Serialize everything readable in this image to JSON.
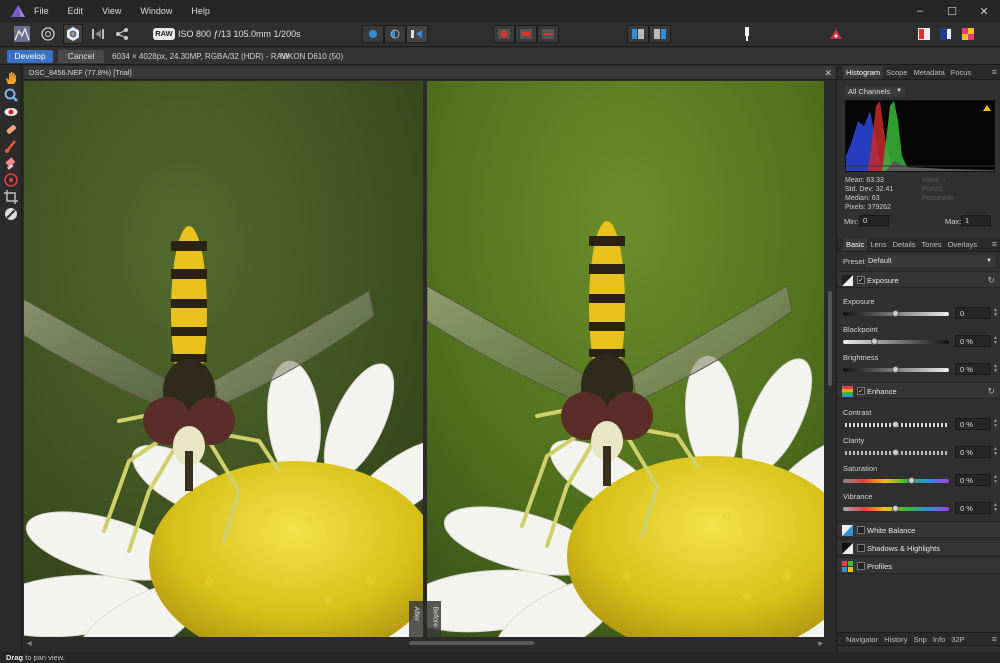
{
  "menu": [
    "File",
    "Edit",
    "View",
    "Window",
    "Help"
  ],
  "toolbar": {
    "raw_badge": "RAW",
    "exif": "ISO 800 ƒ/13 105.0mm 1/200s"
  },
  "context": {
    "develop_label": "Develop",
    "cancel_label": "Cancel",
    "image_info": "6034 × 4028px, 24.30MP, RGBA/32 (HDR) - RAW",
    "camera_info": "NIKON D610 (50)"
  },
  "document": {
    "title": "DSC_8456.NEF (77.8%) [Trial]",
    "after_label": "After",
    "before_label": "Before"
  },
  "histogram_panel": {
    "tabs": [
      "Histogram",
      "Scope",
      "Metadata",
      "Focus"
    ],
    "channel": "All Channels",
    "mean": "Mean: 63.33",
    "std_dev": "Std. Dev: 32.41",
    "median": "Median: 63",
    "pixels": "Pixels: 379262",
    "value_dim": "Value: -",
    "points_dim": "Points: -",
    "percentile_dim": "Percentile: -",
    "min_label": "Min:",
    "min_value": "0",
    "max_label": "Max:",
    "max_value": "1"
  },
  "basic_panel": {
    "tabs": [
      "Basic",
      "Lens",
      "Details",
      "Tones",
      "Overlays"
    ],
    "preset_label": "Preset:",
    "preset_value": "Default",
    "exposure_section": "Exposure",
    "enhance_section": "Enhance",
    "white_balance_section": "White Balance",
    "shadows_section": "Shadows & Highlights",
    "profiles_section": "Profiles",
    "sliders": {
      "exposure": {
        "label": "Exposure",
        "value": "0",
        "level": 0.5
      },
      "blackpoint": {
        "label": "Blackpoint",
        "value": "0 %",
        "level": 0.3
      },
      "brightness": {
        "label": "Brightness",
        "value": "0 %",
        "level": 0.5
      },
      "contrast": {
        "label": "Contrast",
        "value": "0 %",
        "level": 0.5
      },
      "clarity": {
        "label": "Clarity",
        "value": "0 %",
        "level": 0.5
      },
      "saturation": {
        "label": "Saturation",
        "value": "0 %",
        "level": 0.65
      },
      "vibrance": {
        "label": "Vibrance",
        "value": "0 %",
        "level": 0.5
      }
    }
  },
  "bottom_tabs": [
    "Navigator",
    "History",
    "Snp",
    "Info",
    "32P"
  ],
  "status": {
    "bold": "Drag",
    "rest": " to pan view."
  },
  "colors": {
    "accent": "#3b72c2",
    "toolbar_blue": "#2f8fdc",
    "highlight_warning": "#f4c20d"
  }
}
